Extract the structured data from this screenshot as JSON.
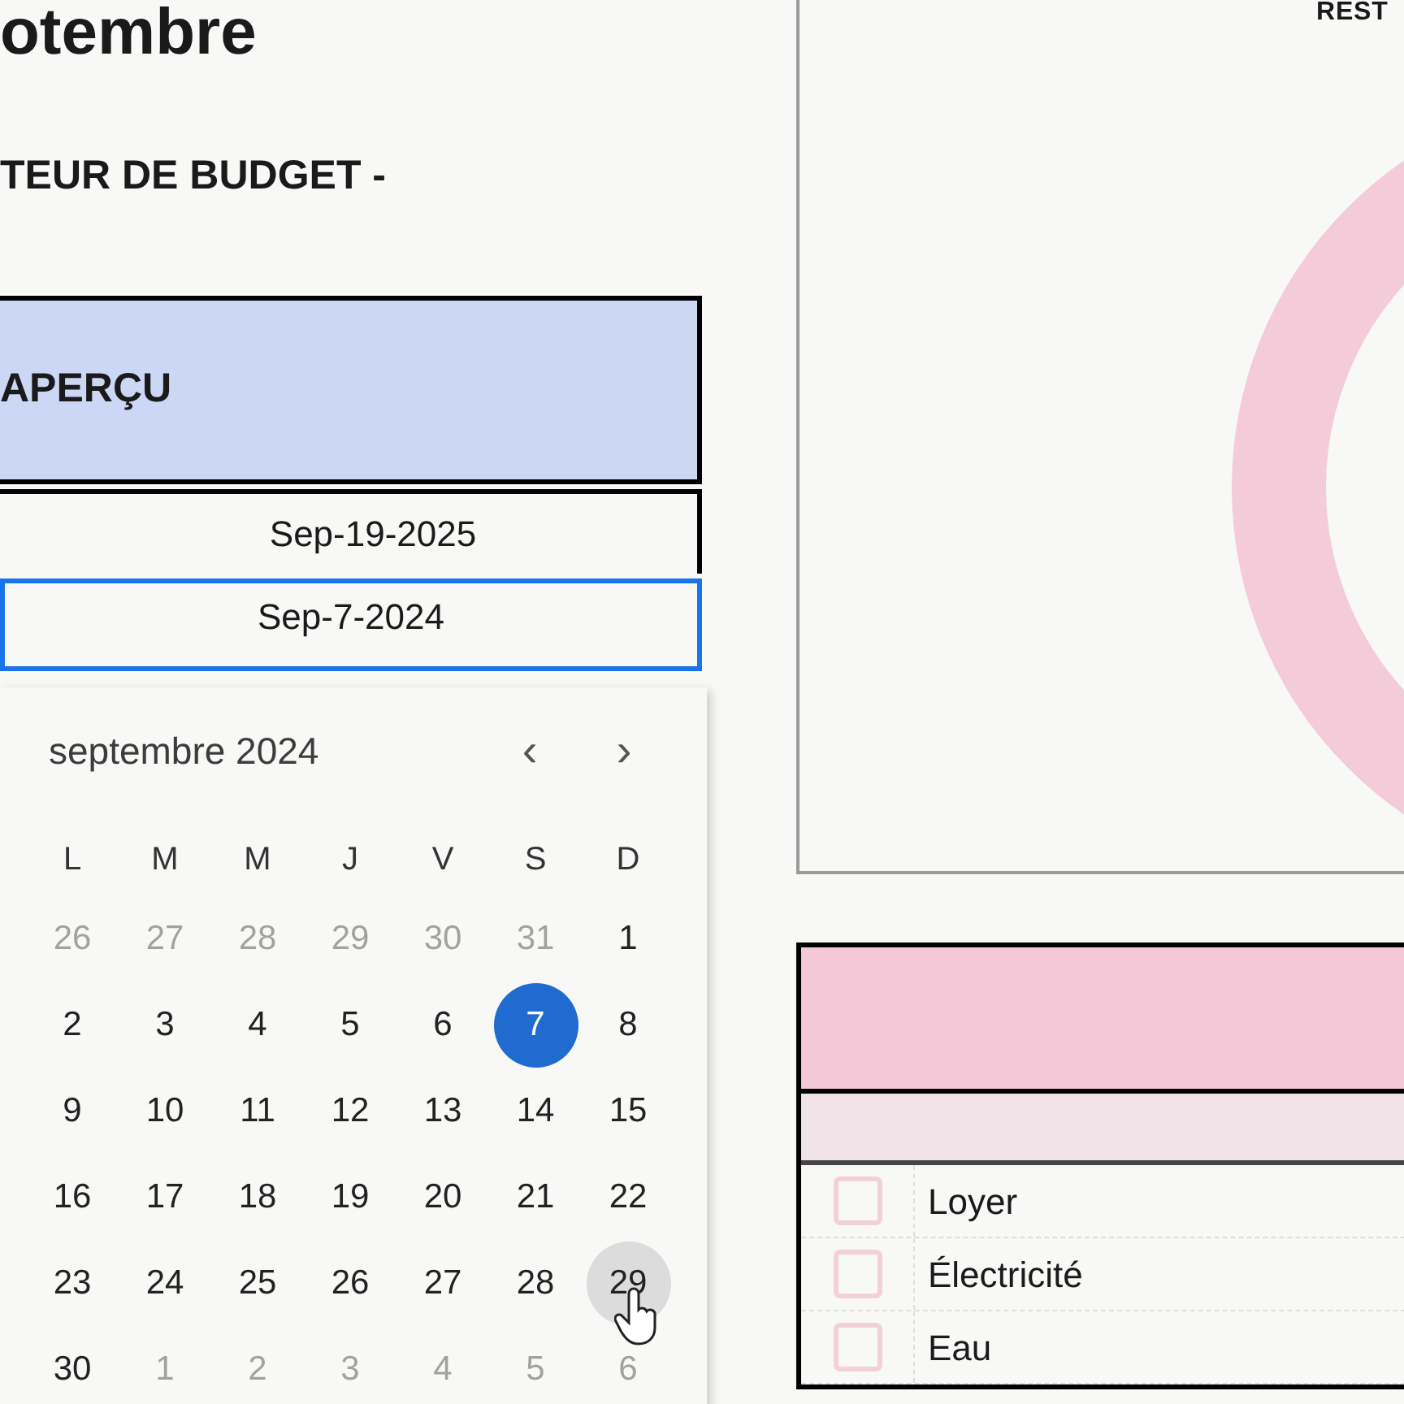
{
  "title": "otembre",
  "subtitle": "TEUR DE BUDGET -",
  "chart_panel": {
    "label": "REST"
  },
  "overview": {
    "header": "APERÇU",
    "rows": [
      {
        "value": "Sep-19-2025",
        "selected": false
      },
      {
        "value": "Sep-7-2024",
        "selected": true
      }
    ]
  },
  "date_picker": {
    "month": "septembre 2024",
    "prev": "‹",
    "next": "›",
    "weekdays": [
      "L",
      "M",
      "M",
      "J",
      "V",
      "S",
      "D"
    ],
    "days": [
      {
        "label": "26",
        "outside": true,
        "selected": false,
        "hovered": false
      },
      {
        "label": "27",
        "outside": true,
        "selected": false,
        "hovered": false
      },
      {
        "label": "28",
        "outside": true,
        "selected": false,
        "hovered": false
      },
      {
        "label": "29",
        "outside": true,
        "selected": false,
        "hovered": false
      },
      {
        "label": "30",
        "outside": true,
        "selected": false,
        "hovered": false
      },
      {
        "label": "31",
        "outside": true,
        "selected": false,
        "hovered": false
      },
      {
        "label": "1",
        "outside": false,
        "selected": false,
        "hovered": false
      },
      {
        "label": "2",
        "outside": false,
        "selected": false,
        "hovered": false
      },
      {
        "label": "3",
        "outside": false,
        "selected": false,
        "hovered": false
      },
      {
        "label": "4",
        "outside": false,
        "selected": false,
        "hovered": false
      },
      {
        "label": "5",
        "outside": false,
        "selected": false,
        "hovered": false
      },
      {
        "label": "6",
        "outside": false,
        "selected": false,
        "hovered": false
      },
      {
        "label": "7",
        "outside": false,
        "selected": true,
        "hovered": false
      },
      {
        "label": "8",
        "outside": false,
        "selected": false,
        "hovered": false
      },
      {
        "label": "9",
        "outside": false,
        "selected": false,
        "hovered": false
      },
      {
        "label": "10",
        "outside": false,
        "selected": false,
        "hovered": false
      },
      {
        "label": "11",
        "outside": false,
        "selected": false,
        "hovered": false
      },
      {
        "label": "12",
        "outside": false,
        "selected": false,
        "hovered": false
      },
      {
        "label": "13",
        "outside": false,
        "selected": false,
        "hovered": false
      },
      {
        "label": "14",
        "outside": false,
        "selected": false,
        "hovered": false
      },
      {
        "label": "15",
        "outside": false,
        "selected": false,
        "hovered": false
      },
      {
        "label": "16",
        "outside": false,
        "selected": false,
        "hovered": false
      },
      {
        "label": "17",
        "outside": false,
        "selected": false,
        "hovered": false
      },
      {
        "label": "18",
        "outside": false,
        "selected": false,
        "hovered": false
      },
      {
        "label": "19",
        "outside": false,
        "selected": false,
        "hovered": false
      },
      {
        "label": "20",
        "outside": false,
        "selected": false,
        "hovered": false
      },
      {
        "label": "21",
        "outside": false,
        "selected": false,
        "hovered": false
      },
      {
        "label": "22",
        "outside": false,
        "selected": false,
        "hovered": false
      },
      {
        "label": "23",
        "outside": false,
        "selected": false,
        "hovered": false
      },
      {
        "label": "24",
        "outside": false,
        "selected": false,
        "hovered": false
      },
      {
        "label": "25",
        "outside": false,
        "selected": false,
        "hovered": false
      },
      {
        "label": "26",
        "outside": false,
        "selected": false,
        "hovered": false
      },
      {
        "label": "27",
        "outside": false,
        "selected": false,
        "hovered": false
      },
      {
        "label": "28",
        "outside": false,
        "selected": false,
        "hovered": false
      },
      {
        "label": "29",
        "outside": false,
        "selected": false,
        "hovered": true
      },
      {
        "label": "30",
        "outside": false,
        "selected": false,
        "hovered": false
      },
      {
        "label": "1",
        "outside": true,
        "selected": false,
        "hovered": false
      },
      {
        "label": "2",
        "outside": true,
        "selected": false,
        "hovered": false
      },
      {
        "label": "3",
        "outside": true,
        "selected": false,
        "hovered": false
      },
      {
        "label": "4",
        "outside": true,
        "selected": false,
        "hovered": false
      },
      {
        "label": "5",
        "outside": true,
        "selected": false,
        "hovered": false
      },
      {
        "label": "6",
        "outside": true,
        "selected": false,
        "hovered": false
      }
    ]
  },
  "checklist": [
    {
      "label": "Loyer",
      "checked": false
    },
    {
      "label": "Électricité",
      "checked": false
    },
    {
      "label": "Eau",
      "checked": false
    }
  ]
}
